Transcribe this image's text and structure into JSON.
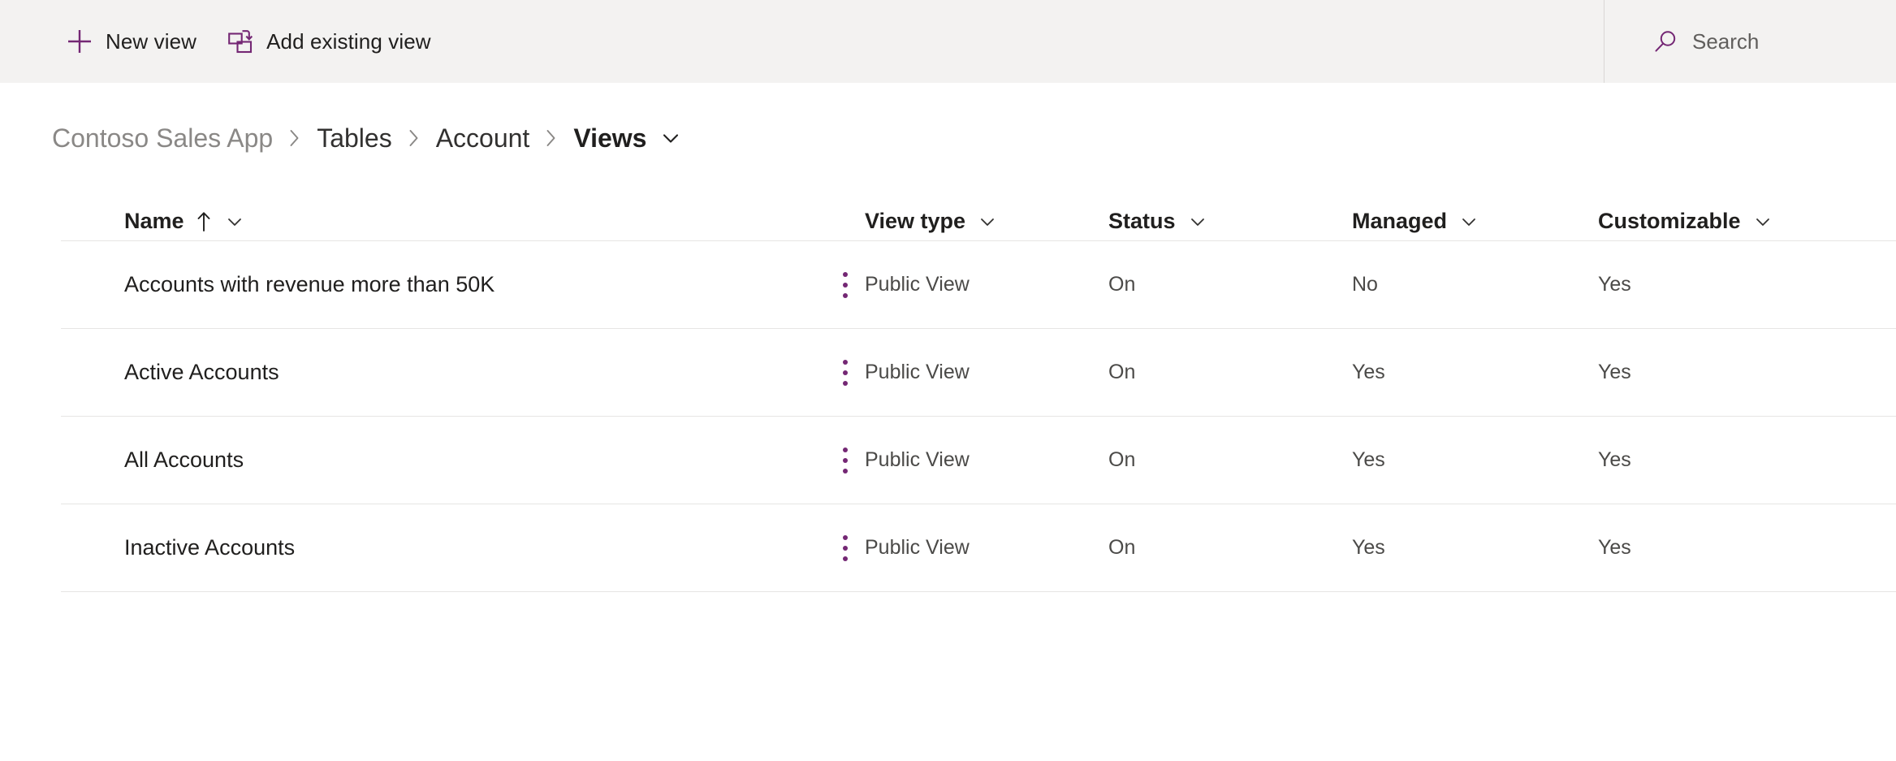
{
  "colors": {
    "accent": "#742774",
    "toolbar_bg": "#f3f2f1",
    "text_primary": "#201f1e",
    "text_secondary": "#605e5c",
    "separator": "#e6e5e4"
  },
  "commandbar": {
    "buttons": [
      {
        "label": "New view",
        "icon": "plus-icon"
      },
      {
        "label": "Add existing view",
        "icon": "add-existing-view-icon"
      }
    ],
    "search": {
      "icon": "search-icon",
      "placeholder": "Search",
      "value": ""
    }
  },
  "breadcrumb": {
    "items": [
      {
        "label": "Contoso Sales App",
        "style": "muted"
      },
      {
        "label": "Tables",
        "style": "normal"
      },
      {
        "label": "Account",
        "style": "normal"
      },
      {
        "label": "Views",
        "style": "current"
      }
    ],
    "separator": "›",
    "dropdown_icon": "chevron-down-icon"
  },
  "table": {
    "columns": [
      {
        "key": "name",
        "label": "Name",
        "sorted": true,
        "sort_direction": "ascending",
        "sort_icon": "arrow-up-icon",
        "menu_icon": "chevron-down-icon"
      },
      {
        "key": "view_type",
        "label": "View type",
        "sorted": false,
        "menu_icon": "chevron-down-icon"
      },
      {
        "key": "status",
        "label": "Status",
        "sorted": false,
        "menu_icon": "chevron-down-icon"
      },
      {
        "key": "managed",
        "label": "Managed",
        "sorted": false,
        "menu_icon": "chevron-down-icon"
      },
      {
        "key": "customizable",
        "label": "Customizable",
        "sorted": false,
        "menu_icon": "chevron-down-icon"
      }
    ],
    "row_menu_icon": "more-vertical-icon",
    "rows": [
      {
        "name": "Accounts with revenue more than 50K",
        "view_type": "Public View",
        "status": "On",
        "managed": "No",
        "customizable": "Yes"
      },
      {
        "name": "Active Accounts",
        "view_type": "Public View",
        "status": "On",
        "managed": "Yes",
        "customizable": "Yes"
      },
      {
        "name": "All Accounts",
        "view_type": "Public View",
        "status": "On",
        "managed": "Yes",
        "customizable": "Yes"
      },
      {
        "name": "Inactive Accounts",
        "view_type": "Public View",
        "status": "On",
        "managed": "Yes",
        "customizable": "Yes"
      }
    ]
  }
}
